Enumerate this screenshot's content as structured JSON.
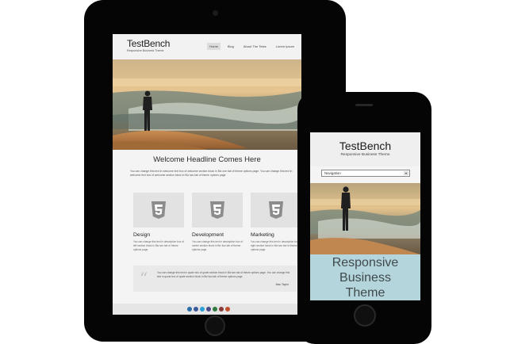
{
  "tablet": {
    "site": {
      "logo": "TestBench",
      "tagline": "Responsive Business Theme",
      "nav": [
        "Home",
        "Blog",
        "About The Tests",
        "Lorem Ipsum"
      ]
    },
    "welcome_heading": "Welcome Headline Comes Here",
    "welcome_text": "You can change this text in welcome text box of welcome section block in Biz one tab of theme options page. You can change this text in welcome text box of welcome section block in Biz two tab of theme options page.",
    "columns": [
      {
        "title": "Design",
        "desc": "You can change this text in description box of left section block in Biz two tab of theme options page.",
        "icon": "html5-icon"
      },
      {
        "title": "Development",
        "desc": "You can change this text in description box of center section block in Biz two tab of theme options page.",
        "icon": "html5-icon"
      },
      {
        "title": "Marketing",
        "desc": "You can change this text in description box of right section block in Biz two tab of theme options page.",
        "icon": "html5-icon"
      }
    ],
    "quote": {
      "text": "You can change this text in quote box of quote section block in Biz two tab of theme options page. You can change this text in quote box of quote section block in Biz two tab of theme options page.",
      "author": "Mac Taylor"
    },
    "social_colors": [
      "#2a6fa8",
      "#3b5a9a",
      "#2aa1d8",
      "#4c4c8a",
      "#2f7b3f",
      "#8a3a3a",
      "#c2502a"
    ]
  },
  "phone": {
    "logo": "TestBench",
    "tagline": "Responsive Business Theme",
    "nav_select": "Navigation",
    "band_text": "Responsive\nBusiness\nTheme"
  }
}
